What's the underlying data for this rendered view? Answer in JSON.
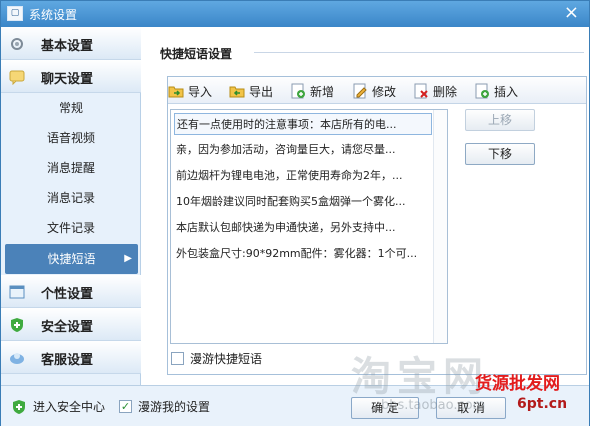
{
  "window": {
    "title": "系统设置",
    "app_icon": "app-icon",
    "close": "×"
  },
  "sidebar": {
    "main_items": [
      {
        "label": "基本设置",
        "icon": "gear-icon"
      },
      {
        "label": "聊天设置",
        "icon": "chat-bubble-icon"
      },
      {
        "label": "个性设置",
        "icon": "window-icon"
      },
      {
        "label": "安全设置",
        "icon": "shield-icon"
      },
      {
        "label": "客服设置",
        "icon": "user-icon"
      }
    ],
    "sub_items": [
      "常规",
      "语音视频",
      "消息提醒",
      "消息记录",
      "文件记录",
      "快捷短语"
    ],
    "selected_sub": "快捷短语"
  },
  "content": {
    "section_title": "快捷短语设置",
    "toolbar": [
      "导入",
      "导出",
      "新增",
      "修改",
      "删除",
      "插入"
    ],
    "list": [
      "还有一点使用时的注意事项：本店所有的电...",
      "亲，因为参加活动，咨询量巨大，请您尽量...",
      "前边烟杆为锂电电池，正常使用寿命为2年，...",
      "10年烟龄建议同时配套购买5盒烟弹一个雾化...",
      "本店默认包邮快递为申通快递，另外支持中...",
      "外包装盒尺寸:90*92mm配件：雾化器：1个可..."
    ],
    "move_up": "上移",
    "move_down": "下移",
    "roaming_checkbox": "漫游快捷短语"
  },
  "bottom": {
    "security_center": "进入安全中心",
    "roam_settings": "漫游我的设置",
    "ok": "确 定",
    "cancel": "取 消"
  },
  "watermark": {
    "text": "淘宝网",
    "url": "bbs.taobao.com",
    "red_text": "货源批发网",
    "site": "6pt.cn"
  }
}
